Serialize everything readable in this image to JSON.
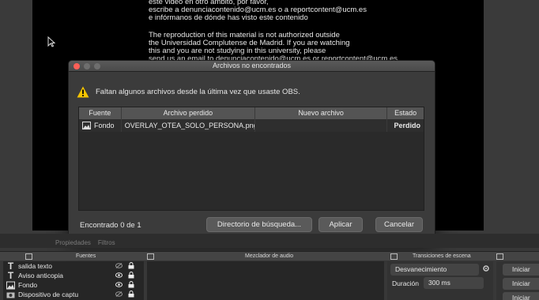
{
  "preview": {
    "lines": [
      "este video en otro ámbito, por favor,",
      "escribe a denunciacontenido@ucm.es o a reportcontent@ucm.es",
      "e infórmanos de dónde has visto este contenido",
      "",
      "The reproduction of this material is not authorized outside",
      "the Universidad Complutense de Madrid. If you are watching",
      "this and you are not studying in this university, please",
      "send us an email to denunciacontenido@ucm.es or reportcontent@ucm.es"
    ]
  },
  "dialog": {
    "title": "Archivos no encontrados",
    "warning": "Faltan algunos archivos desde la última vez que usaste OBS.",
    "columns": [
      "Fuente",
      "Archivo perdido",
      "Nuevo archivo",
      "Estado"
    ],
    "rows": [
      {
        "source": "Fondo",
        "file": "OVERLAY_OTEA_SOLO_PERSONA.png",
        "new_file": "",
        "status": "Perdido"
      }
    ],
    "found": "Encontrado 0 de 1",
    "buttons": {
      "search_dir": "Directorio de búsqueda...",
      "apply": "Aplicar",
      "cancel": "Cancelar"
    }
  },
  "props_bar": {
    "properties": "Propiedades",
    "filters": "Filtros"
  },
  "docks": {
    "sources_title": "Fuentes",
    "mixer_title": "Mezclador de audio",
    "transitions_title": "Transiciones de escena"
  },
  "sources": [
    {
      "label": "salida texto",
      "icon": "text-icon"
    },
    {
      "label": "Aviso anticopia",
      "icon": "text-icon"
    },
    {
      "label": "Fondo",
      "icon": "image-icon"
    },
    {
      "label": "Dispositivo de captu",
      "icon": "camera-icon"
    }
  ],
  "transitions": {
    "selected": "Desvanecimiento",
    "duration_label": "Duración",
    "duration_value": "300 ms"
  },
  "controls": {
    "start_stream": "Iniciar",
    "start_record": "Iniciar",
    "start_virtual": "Iniciar"
  },
  "colors": {
    "accent_red": "#fd5f57",
    "warning_yellow": "#f5c400"
  }
}
